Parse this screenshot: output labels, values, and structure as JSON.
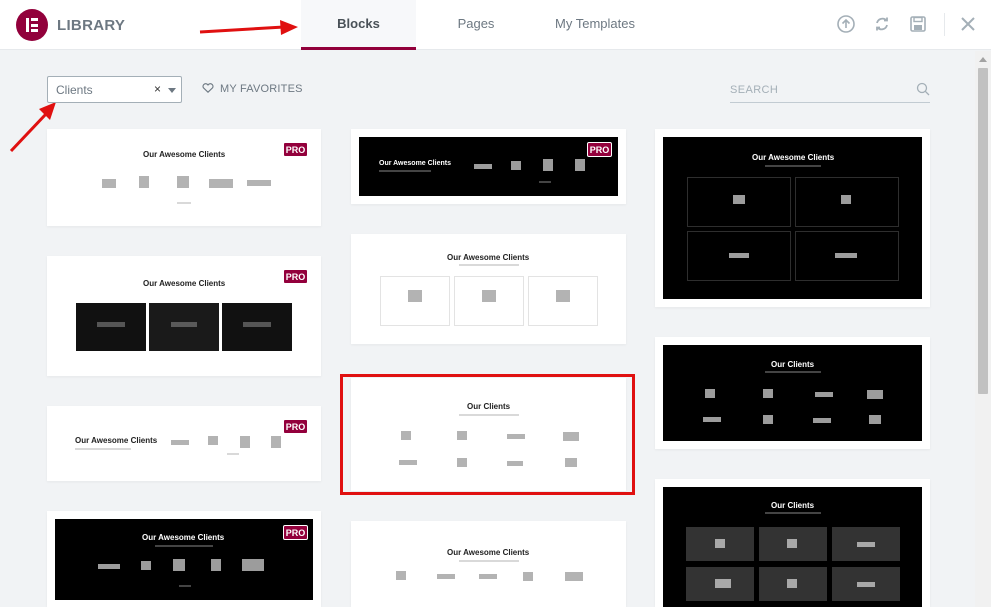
{
  "header": {
    "title": "LIBRARY",
    "tabs": [
      {
        "label": "Blocks",
        "active": true
      },
      {
        "label": "Pages",
        "active": false
      },
      {
        "label": "My Templates",
        "active": false
      }
    ],
    "icons": [
      "upload-icon",
      "sync-icon",
      "save-icon",
      "close-icon"
    ]
  },
  "toolbar": {
    "category_value": "Clients",
    "clear_glyph": "×",
    "favorites_label": "MY FAVORITES",
    "search_placeholder": "SEARCH"
  },
  "colors": {
    "brand": "#92003b",
    "annotation_red": "#e01010",
    "background": "#f1f3f5"
  },
  "cards": {
    "c1": {
      "title": "Our Awesome Clients",
      "pro": "PRO"
    },
    "c2": {
      "title": "Our Awesome Clients",
      "pro": "PRO"
    },
    "c3": {
      "title": "Our Awesome Clients",
      "pro": "PRO"
    },
    "c4": {
      "title": "Our Awesome Clients",
      "pro": "PRO"
    },
    "c5": {
      "title": "Our Awesome Clients",
      "pro": "PRO"
    },
    "c6": {
      "title": "Our Awesome Clients"
    },
    "c7": {
      "title": "Our Clients"
    },
    "c8": {
      "title": "Our Awesome Clients"
    },
    "c9": {
      "title": "Our Awesome Clients"
    },
    "c10": {
      "title": "Our Clients"
    },
    "c11": {
      "title": "Our Clients"
    }
  }
}
